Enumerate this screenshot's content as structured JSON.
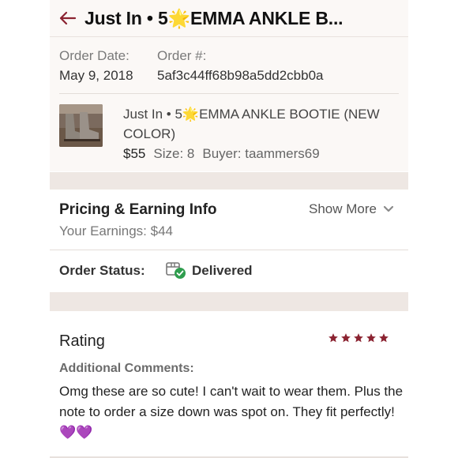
{
  "header": {
    "title": "Just In • 5🌟EMMA ANKLE B...",
    "accent_color": "#8b2331"
  },
  "order": {
    "date_label": "Order Date:",
    "date_value": "May 9, 2018",
    "number_label": "Order #:",
    "number_value": "5af3c44ff68b98a5dd2cbb0a"
  },
  "item": {
    "title": "Just In • 5🌟EMMA ANKLE BOOTIE (NEW COLOR)",
    "price": "$55",
    "size": "Size: 8",
    "buyer": "Buyer: taammers69"
  },
  "pricing": {
    "heading": "Pricing & Earning Info",
    "earnings": "Your Earnings: $44",
    "show_more": "Show More"
  },
  "status": {
    "label": "Order Status:",
    "value": "Delivered",
    "icon": "package-delivered-icon"
  },
  "rating": {
    "heading": "Rating",
    "stars": 5,
    "star_color": "#8b2331",
    "comments_label": "Additional Comments:",
    "comment": "Omg these are so cute! I can't wait to wear them. Plus the note to order a size down was spot on. They fit perfectly! 💜💜"
  }
}
